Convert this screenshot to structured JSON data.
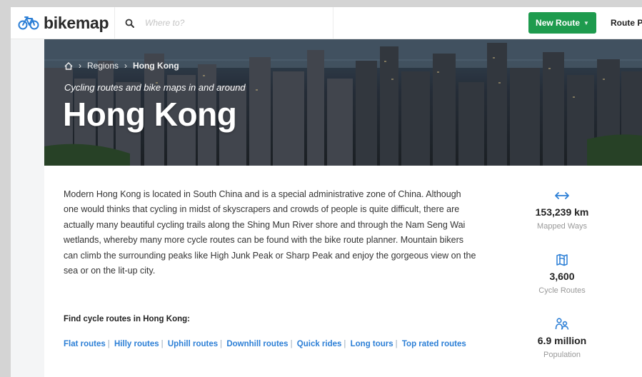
{
  "nav": {
    "logo_text": "bikemap",
    "search_placeholder": "Where to?",
    "new_route_label": "New Route",
    "route_planner_label": "Route P"
  },
  "hero": {
    "breadcrumbs": [
      "Regions",
      "Hong Kong"
    ],
    "subtitle": "Cycling routes and bike maps in and around",
    "title": "Hong Kong"
  },
  "content": {
    "description": "Modern Hong Kong is located in South China and is a special administrative zone of China. Although one would thinks that cycling in midst of skyscrapers and crowds of people is quite difficult, there are actually many beautiful cycling trails along the Shing Mun River shore and through the Nam Seng Wai wetlands, whereby many more cycle routes can be found with the bike route planner. Mountain bikers can climb the surrounding peaks like High Junk Peak or Sharp Peak and enjoy the gorgeous view on the sea or on the lit-up city.",
    "find_title": "Find cycle routes in Hong Kong:",
    "route_links": [
      "Flat routes",
      "Hilly routes",
      "Uphill routes",
      "Downhill routes",
      "Quick rides",
      "Long tours",
      "Top rated routes"
    ]
  },
  "stats": [
    {
      "icon": "arrows-horizontal-icon",
      "value": "153,239 km",
      "label": "Mapped Ways"
    },
    {
      "icon": "map-icon",
      "value": "3,600",
      "label": "Cycle Routes"
    },
    {
      "icon": "people-icon",
      "value": "6.9 million",
      "label": "Population"
    }
  ],
  "colors": {
    "accent_green": "#1e9b4e",
    "link_blue": "#2c7fd6"
  }
}
